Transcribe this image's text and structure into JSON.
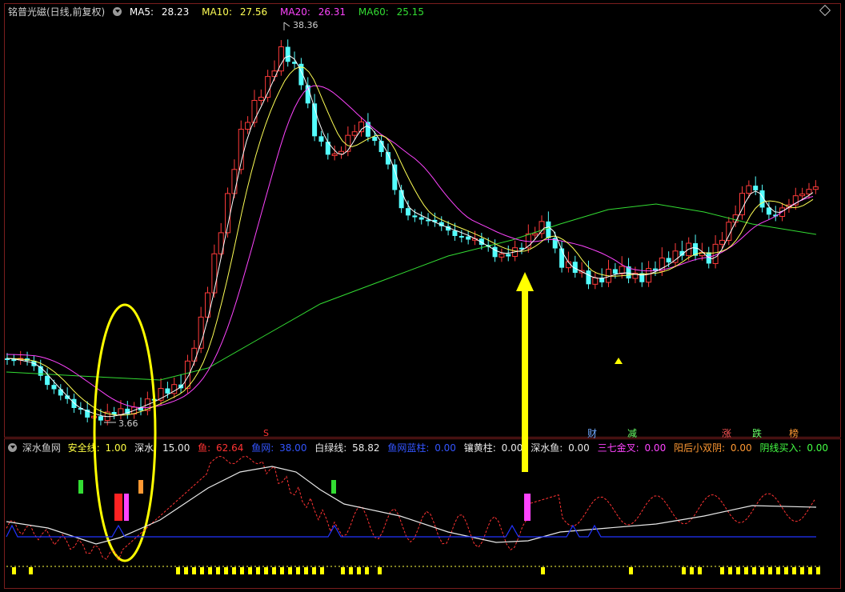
{
  "main_panel": {
    "title": "铭普光磁(日线,前复权)",
    "ma": [
      {
        "label": "MA5:",
        "value": "28.23",
        "color": "#ffffff"
      },
      {
        "label": "MA10:",
        "value": "27.56",
        "color": "#ffff55"
      },
      {
        "label": "MA20:",
        "value": "26.31",
        "color": "#ff44ff"
      },
      {
        "label": "MA60:",
        "value": "25.15",
        "color": "#33dd33"
      }
    ],
    "high_label": "38.36",
    "low_label": "3.66",
    "s_marker": "S",
    "badges": [
      {
        "text": "财",
        "color": "#6fa8ff"
      },
      {
        "text": "减",
        "color": "#66ff66"
      },
      {
        "text": "涨",
        "color": "#ff5555"
      },
      {
        "text": "跌",
        "color": "#66ff66"
      },
      {
        "text": "榜",
        "color": "#ff9933"
      }
    ]
  },
  "sub_panel": {
    "name": "深水鱼网",
    "items": [
      {
        "label": "安全线:",
        "value": "1.00",
        "color": "#ffff44"
      },
      {
        "label": "深水:",
        "value": "15.00",
        "color": "#e8e8e8"
      },
      {
        "label": "鱼:",
        "value": "62.64",
        "color": "#ff3333"
      },
      {
        "label": "鱼网:",
        "value": "38.00",
        "color": "#3355ff"
      },
      {
        "label": "白绿线:",
        "value": "58.82",
        "color": "#e8e8e8"
      },
      {
        "label": "鱼网蓝柱:",
        "value": "0.00",
        "color": "#3355ff"
      },
      {
        "label": "镶黄柱:",
        "value": "0.00",
        "color": "#e8e8e8"
      },
      {
        "label": "深水鱼:",
        "value": "0.00",
        "color": "#e8e8e8"
      },
      {
        "label": "三七金叉:",
        "value": "0.00",
        "color": "#ff44ff"
      },
      {
        "label": "阳后小双阴:",
        "value": "0.00",
        "color": "#ff9933"
      },
      {
        "label": "阴线买入:",
        "value": "0.00",
        "color": "#44ff44"
      }
    ]
  },
  "colors": {
    "up": "#ff3b3b",
    "down": "#54ffff",
    "ma5": "#ffffff",
    "ma10": "#ffff55",
    "ma20": "#ff44ff",
    "ma60": "#33dd33",
    "frame": "#7a1d1d",
    "annotation": "#ffff00"
  },
  "icons": [
    "indicator-dropdown-icon",
    "expand-diamond-icon",
    "buy-arrow-icon",
    "highlight-ellipse-icon",
    "triangle-marker-icon"
  ]
}
